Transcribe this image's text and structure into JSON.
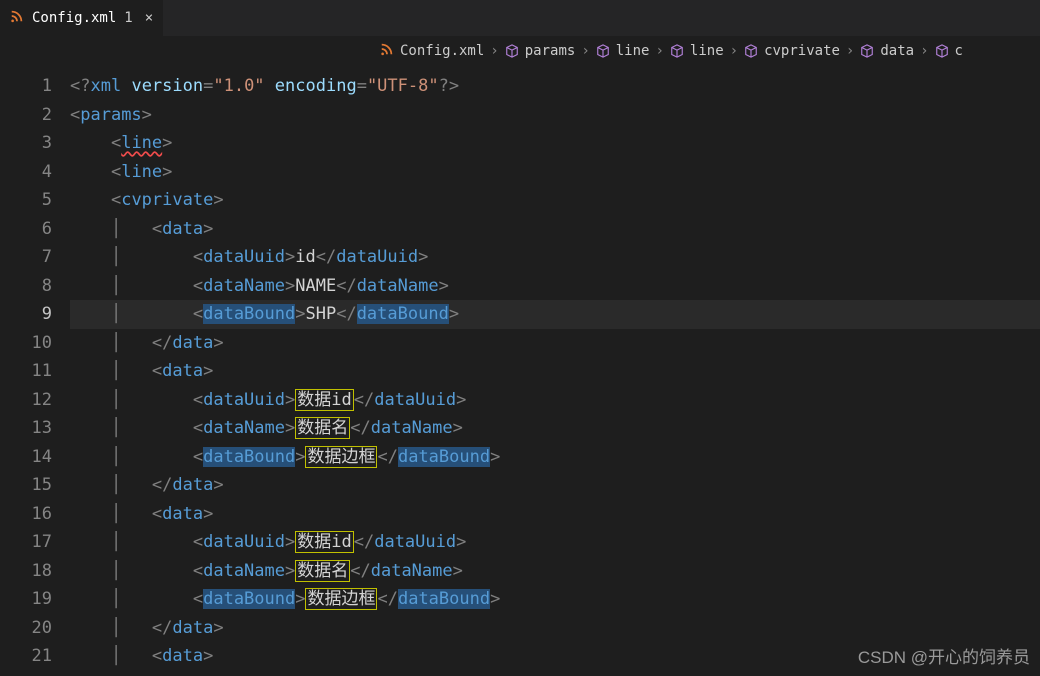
{
  "tab": {
    "title": "Config.xml",
    "modified": "1",
    "close": "×"
  },
  "breadcrumb": {
    "file": "Config.xml",
    "items": [
      "params",
      "line",
      "line",
      "cvprivate",
      "data"
    ],
    "overflow": "c"
  },
  "editor": {
    "current_line": 9,
    "lines": [
      {
        "n": 1,
        "indent": 0,
        "t": "xml-decl",
        "ver": "1.0",
        "enc": "UTF-8"
      },
      {
        "n": 2,
        "indent": 0,
        "t": "open",
        "tag": "params"
      },
      {
        "n": 3,
        "indent": 1,
        "t": "open",
        "tag": "line",
        "squiggle": true
      },
      {
        "n": 4,
        "indent": 1,
        "t": "open",
        "tag": "line"
      },
      {
        "n": 5,
        "indent": 1,
        "t": "open",
        "tag": "cvprivate"
      },
      {
        "n": 6,
        "indent": 2,
        "t": "open",
        "tag": "data"
      },
      {
        "n": 7,
        "indent": 3,
        "t": "leaf",
        "tag": "dataUuid",
        "val": "id"
      },
      {
        "n": 8,
        "indent": 3,
        "t": "leaf",
        "tag": "dataName",
        "val": "NAME"
      },
      {
        "n": 9,
        "indent": 3,
        "t": "leaf",
        "tag": "dataBound",
        "val": "SHP",
        "seltag": true
      },
      {
        "n": 10,
        "indent": 2,
        "t": "close",
        "tag": "data"
      },
      {
        "n": 11,
        "indent": 2,
        "t": "open",
        "tag": "data"
      },
      {
        "n": 12,
        "indent": 3,
        "t": "leaf",
        "tag": "dataUuid",
        "val": "数据id",
        "box": true
      },
      {
        "n": 13,
        "indent": 3,
        "t": "leaf",
        "tag": "dataName",
        "val": "数据名",
        "box": true
      },
      {
        "n": 14,
        "indent": 3,
        "t": "leaf",
        "tag": "dataBound",
        "val": "数据边框",
        "box": true,
        "seltag": true
      },
      {
        "n": 15,
        "indent": 2,
        "t": "close",
        "tag": "data"
      },
      {
        "n": 16,
        "indent": 2,
        "t": "open",
        "tag": "data"
      },
      {
        "n": 17,
        "indent": 3,
        "t": "leaf",
        "tag": "dataUuid",
        "val": "数据id",
        "box": true
      },
      {
        "n": 18,
        "indent": 3,
        "t": "leaf",
        "tag": "dataName",
        "val": "数据名",
        "box": true
      },
      {
        "n": 19,
        "indent": 3,
        "t": "leaf",
        "tag": "dataBound",
        "val": "数据边框",
        "box": true,
        "seltag": true
      },
      {
        "n": 20,
        "indent": 2,
        "t": "close",
        "tag": "data"
      },
      {
        "n": 21,
        "indent": 2,
        "t": "open",
        "tag": "data"
      }
    ]
  },
  "watermark": "CSDN @开心的饲养员"
}
